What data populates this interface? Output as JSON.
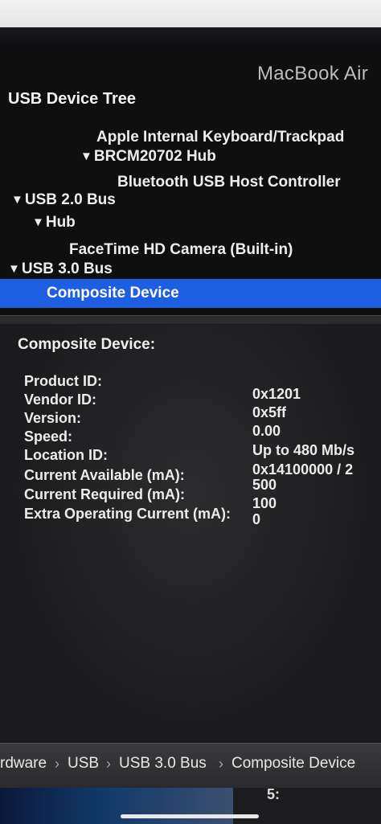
{
  "window": {
    "machine_name": "MacBook Air"
  },
  "tree": {
    "header": "USB Device Tree",
    "items": [
      {
        "label": "Apple Internal Keyboard/Trackpad",
        "expanded": null
      },
      {
        "label": "BRCM20702 Hub",
        "expanded": true
      },
      {
        "label": "Bluetooth USB Host Controller",
        "expanded": null
      },
      {
        "label": "USB 2.0 Bus",
        "expanded": true
      },
      {
        "label": "Hub",
        "expanded": true
      },
      {
        "label": "FaceTime HD Camera (Built-in)",
        "expanded": null
      },
      {
        "label": "USB 3.0 Bus",
        "expanded": true
      },
      {
        "label": "Composite Device",
        "expanded": null,
        "selected": true
      }
    ],
    "triangle_glyph": "▼"
  },
  "detail": {
    "title": "Composite Device:",
    "properties": [
      {
        "label": "Product ID:",
        "value": "0x1201"
      },
      {
        "label": "Vendor ID:",
        "value": "0x5ff"
      },
      {
        "label": "Version:",
        "value": "0.00"
      },
      {
        "label": "Speed:",
        "value": "Up to 480 Mb/s"
      },
      {
        "label": "Location ID:",
        "value": "0x14100000 / 2"
      },
      {
        "label": "Current Available (mA):",
        "value": "500"
      },
      {
        "label": "Current Required (mA):",
        "value": "100"
      },
      {
        "label": "Extra Operating Current (mA):",
        "value": "0"
      }
    ]
  },
  "pathbar": {
    "crumbs": [
      "rdware",
      "USB",
      "USB 3.0 Bus",
      "Composite Device"
    ],
    "separator": "›"
  },
  "bottom": {
    "snippet": "5:"
  },
  "colors": {
    "selection": "#1e5fe1",
    "background": "#0c0c0d",
    "detail_background": "#232325",
    "text": "#ececec"
  }
}
